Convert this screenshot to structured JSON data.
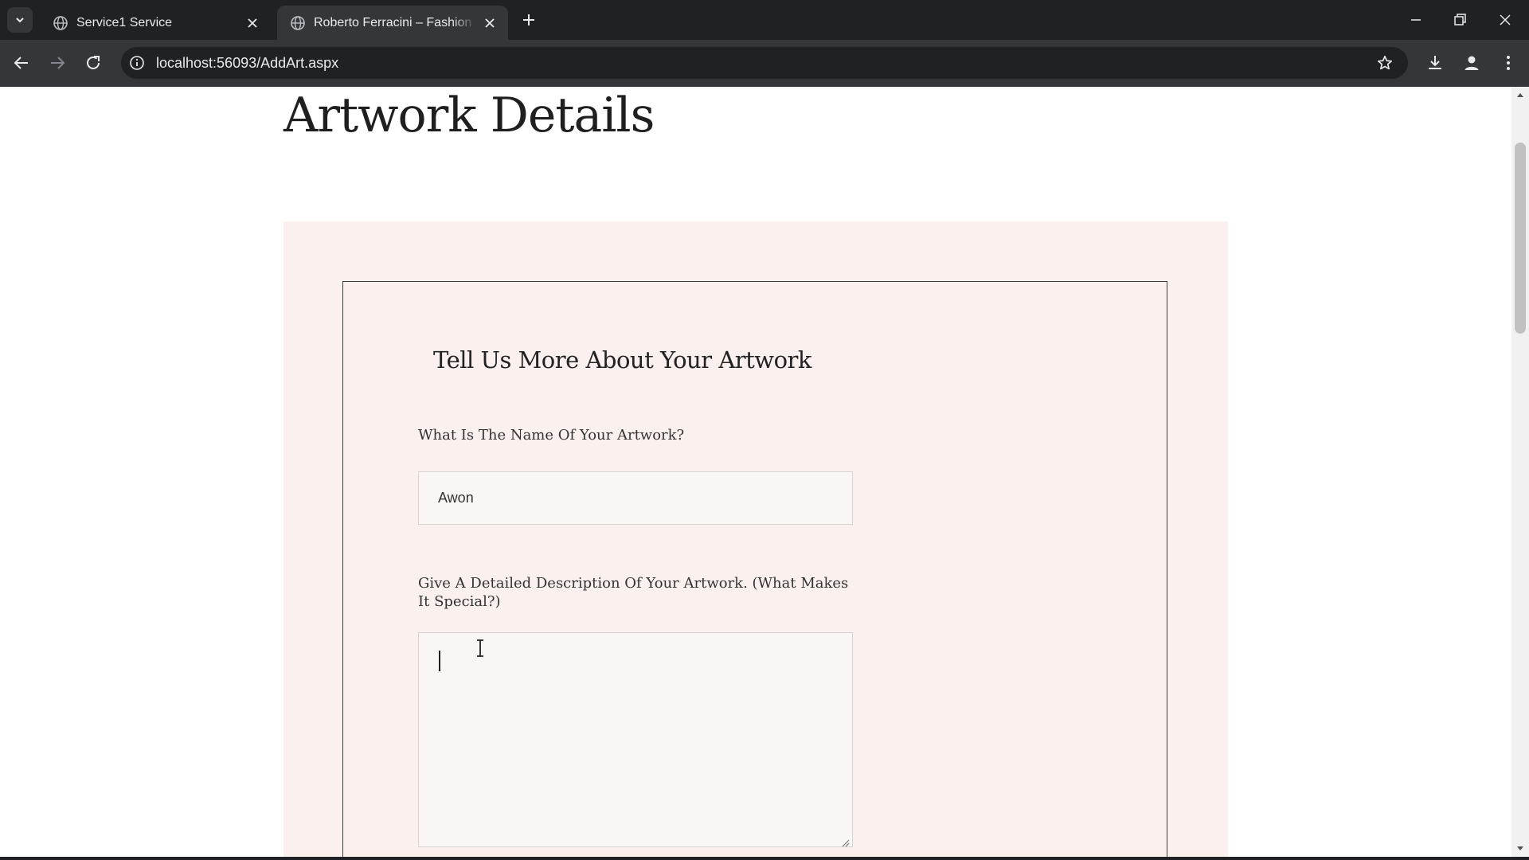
{
  "browser": {
    "tabs": [
      {
        "title": "Service1 Service",
        "active": false
      },
      {
        "title": "Roberto Ferracini – Fashion and",
        "active": true
      }
    ],
    "url": "localhost:56093/AddArt.aspx",
    "icons": [
      "tab-search-icon",
      "globe-icon",
      "close-icon",
      "plus-icon",
      "minimize-icon",
      "restore-icon",
      "close-window-icon",
      "back-icon",
      "forward-icon",
      "reload-icon",
      "info-icon",
      "star-icon",
      "download-icon",
      "profile-icon",
      "menu-icon"
    ]
  },
  "page": {
    "title": "Artwork Details",
    "form": {
      "heading": "Tell Us More About Your Artwork",
      "name_label": "What Is The Name Of Your Artwork?",
      "name_value": "Awon",
      "description_label": "Give A Detailed Description Of Your Artwork. (What Makes It Special?)",
      "description_value": ""
    }
  },
  "colors": {
    "chrome_dark": "#202124",
    "chrome_tab": "#35363a",
    "panel_background": "#faf1ee",
    "card_border": "#3d3d3d"
  }
}
